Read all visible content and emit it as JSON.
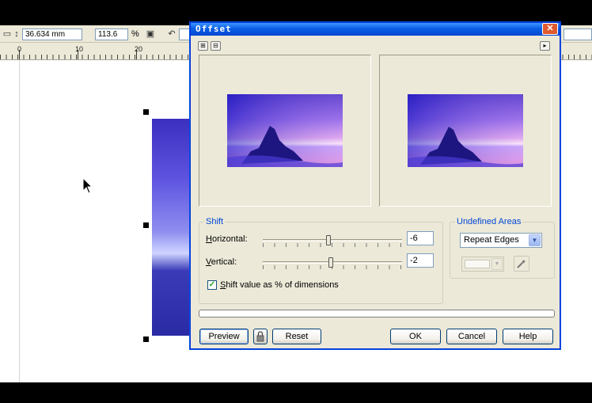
{
  "propbar": {
    "measure_value": "36.634 mm",
    "scale_value": "113.6",
    "scale_unit": "%"
  },
  "ruler": {
    "labels": [
      "0",
      "10",
      "20"
    ]
  },
  "dialog": {
    "title": "Offset",
    "close_glyph": "✕",
    "shift": {
      "title": "Shift",
      "horizontal_label": "orizontal:",
      "horizontal_mnemonic": "H",
      "horizontal_value": "-6",
      "horizontal_fraction": 0.47,
      "vertical_label": "ertical:",
      "vertical_mnemonic": "V",
      "vertical_value": "-2",
      "vertical_fraction": 0.49,
      "checkbox_label": "hift value as % of dimensions",
      "checkbox_mnemonic": "S",
      "checkbox_checked": true
    },
    "undefined_areas": {
      "title": "Undefined Areas",
      "selected": "Repeat Edges"
    },
    "buttons": {
      "preview": "Preview",
      "reset": "Reset",
      "ok": "OK",
      "cancel": "Cancel",
      "help": "Help"
    }
  },
  "colors": {
    "titlebar": "#0a5ee6",
    "group_title": "#0046d5",
    "dialog_bg": "#ece9d8"
  },
  "icons": {
    "propbar_measure": "vertical-size-icon",
    "propbar_lock": "lock-ratio-icon",
    "propbar_rotate": "rotate-icon",
    "preview_zoom_in": "zoom-in-icon",
    "preview_zoom_out": "zoom-out-icon",
    "preview_play": "play-icon",
    "eyedropper": "eyedropper-icon",
    "lock": "lock-icon"
  }
}
